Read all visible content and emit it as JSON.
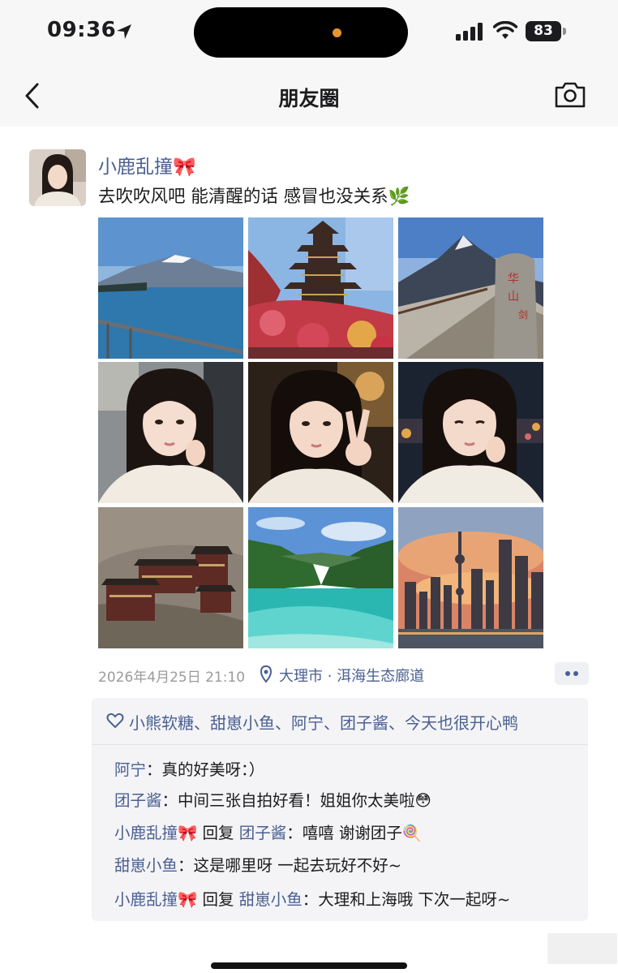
{
  "status_bar": {
    "time": "09:36",
    "battery": "83"
  },
  "nav": {
    "title": "朋友圈"
  },
  "post": {
    "author": "小鹿乱撞🎀",
    "text": "去吹吹风吧 能清醒的话 感冒也没关系🌿",
    "photos": [
      {
        "name": "snow-mountain-lake-photo"
      },
      {
        "name": "pagoda-flowers-photo"
      },
      {
        "name": "huashan-stone-photo"
      },
      {
        "name": "selfie-car-photo"
      },
      {
        "name": "selfie-peace-sign-photo"
      },
      {
        "name": "selfie-night-photo"
      },
      {
        "name": "hanging-temple-photo"
      },
      {
        "name": "turquoise-lake-valley-photo"
      },
      {
        "name": "shanghai-skyline-sunset-photo"
      }
    ],
    "timestamp": "2026年4月25日 21:10",
    "location": "大理市 · 洱海生态廊道"
  },
  "likes": "小熊软糖、甜崽小鱼、阿宁、团子酱、今天也很开心鸭",
  "comments": [
    {
      "name": "阿宁",
      "text": "：真的好美呀：）"
    },
    {
      "name": "团子酱",
      "text": "：中间三张自拍好看！姐姐你太美啦😳"
    },
    {
      "name": "小鹿乱撞🎀",
      "reply_word": " 回复 ",
      "reply_to": "团子酱",
      "text": "：嘻嘻 谢谢团子🍭"
    },
    {
      "name": "甜崽小鱼",
      "text": "：这是哪里呀 一起去玩好不好~"
    },
    {
      "name": "小鹿乱撞🎀",
      "reply_word": " 回复 ",
      "reply_to": "甜崽小鱼",
      "text": "：大理和上海哦 下次一起呀~"
    }
  ],
  "colors": {
    "link": "#4a5f92",
    "box": "#f4f4f6"
  }
}
